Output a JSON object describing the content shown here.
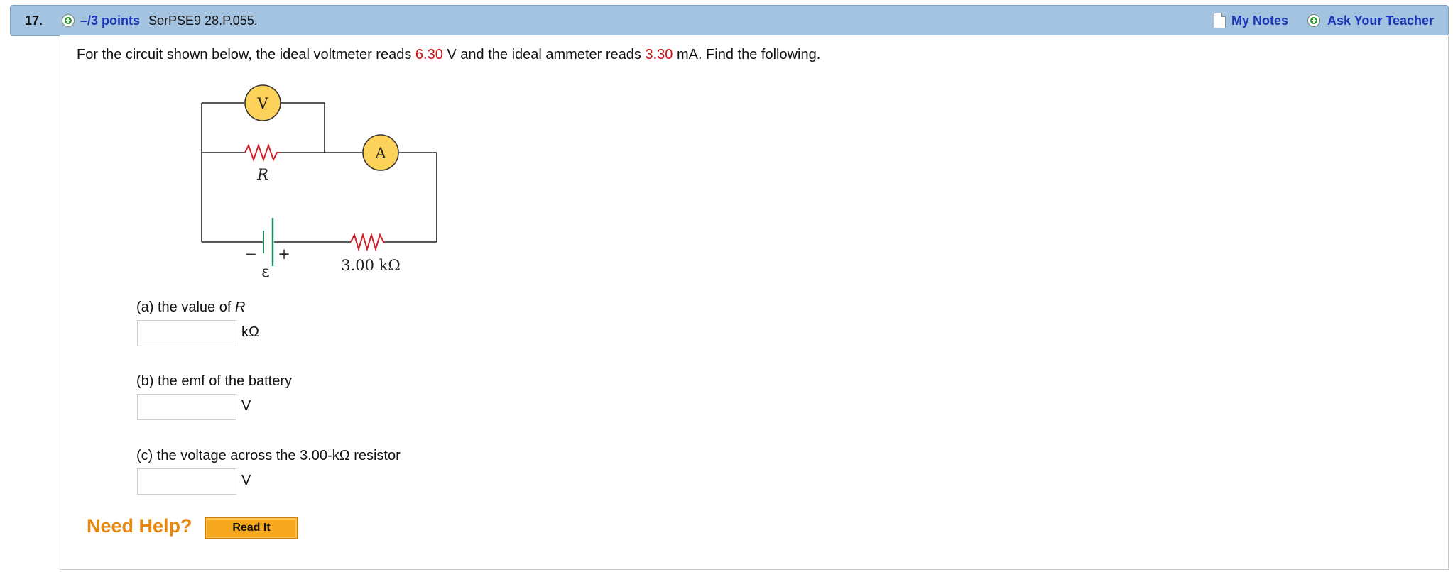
{
  "header": {
    "question_number": "17.",
    "points_label": "–/3 points",
    "problem_code": "SerPSE9 28.P.055.",
    "my_notes_label": "My Notes",
    "ask_teacher_label": "Ask Your Teacher"
  },
  "problem": {
    "intro_part1": "For the circuit shown below, the ideal voltmeter reads ",
    "voltmeter_reading": "6.30",
    "intro_part2": " V and the ideal ammeter reads ",
    "ammeter_reading": "3.30",
    "intro_part3": " mA. Find the following."
  },
  "circuit": {
    "voltmeter_symbol": "V",
    "ammeter_symbol": "A",
    "resistor_label": "R",
    "battery_minus": "−",
    "battery_plus": "+",
    "emf_label": "ε",
    "fixed_resistor_label": "3.00 kΩ"
  },
  "parts": [
    {
      "prompt_prefix": "(a) the value of ",
      "prompt_var": "R",
      "unit": "kΩ",
      "value": ""
    },
    {
      "prompt_prefix": "(b) the emf of the battery",
      "prompt_var": "",
      "unit": "V",
      "value": ""
    },
    {
      "prompt_prefix": "(c) the voltage across the 3.00-kΩ resistor",
      "prompt_var": "",
      "unit": "V",
      "value": ""
    }
  ],
  "help": {
    "label": "Need Help?",
    "read_it_button": "Read It"
  },
  "colors": {
    "header_bg": "#a3c3e0",
    "link": "#1a35b8",
    "highlight_red": "#cc1111",
    "help_orange": "#e8870e",
    "meter_yellow": "#fcd25a",
    "resistor_red": "#d0202a",
    "battery_green": "#1d8f5a"
  }
}
